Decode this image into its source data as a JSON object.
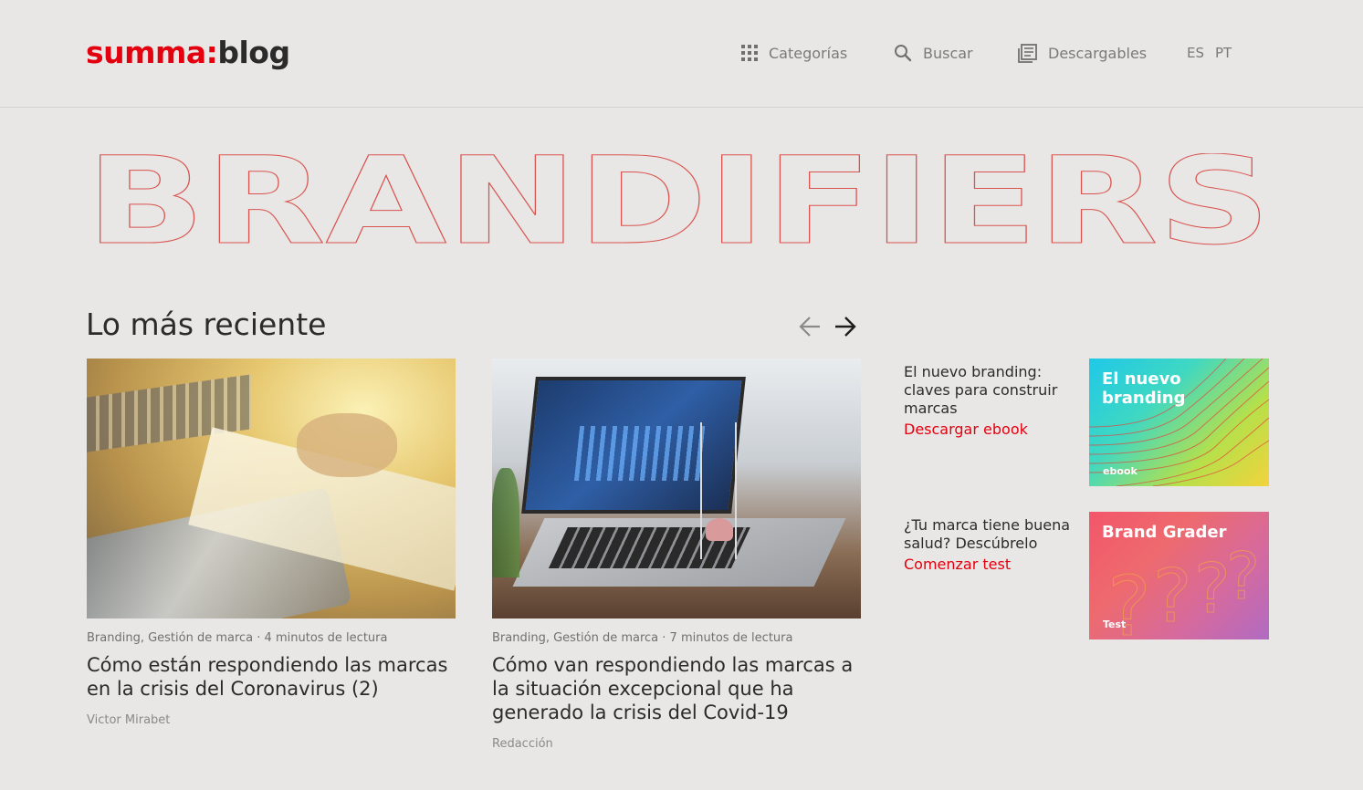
{
  "header": {
    "logo_brand": "summa:",
    "logo_suffix": "blog",
    "nav": {
      "categories_label": "Categorías",
      "search_label": "Buscar",
      "downloads_label": "Descargables"
    },
    "lang_es": "ES",
    "lang_pt": "PT"
  },
  "hero": {
    "text": "BRANDIFIERS"
  },
  "recent": {
    "title": "Lo más reciente",
    "articles": [
      {
        "categories": "Branding, Gestión de marca",
        "read_time": "· 4 minutos de lectura",
        "title": "Cómo están respondiendo las marcas en la crisis del Coronavirus (2)",
        "author": "Victor Mirabet"
      },
      {
        "categories": "Branding, Gestión de marca",
        "read_time": "· 7 minutos de lectura",
        "title": "Cómo van respondiendo las marcas a la situación excepcional que ha generado la crisis del Covid-19",
        "author": "Redacción"
      }
    ]
  },
  "promos": [
    {
      "text": "El nuevo branding: claves para construir marcas",
      "link": "Descargar ebook",
      "thumb_title": "El nuevo branding",
      "thumb_tag": "ebook"
    },
    {
      "text": "¿Tu marca tiene buena salud? Descúbrelo",
      "link": "Comenzar test",
      "thumb_title": "Brand Grader",
      "thumb_tag": "Test"
    }
  ],
  "colors": {
    "brand_red": "#e3000f",
    "background": "#e8e7e5"
  }
}
